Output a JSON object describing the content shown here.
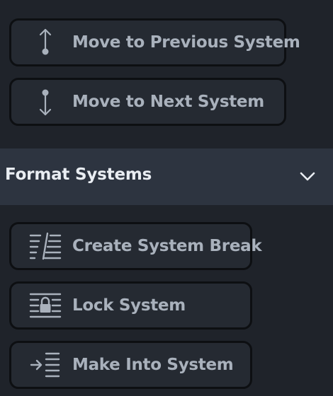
{
  "navigation": {
    "move_previous_label": "Move to Previous System",
    "move_next_label": "Move to Next System"
  },
  "format_systems": {
    "title": "Format Systems",
    "expanded": true,
    "buttons": {
      "create_system_break_label": "Create System Break",
      "lock_system_label": "Lock System",
      "make_into_system_label": "Make Into System"
    }
  },
  "icons": {
    "move_previous": "move-up-arrow-icon",
    "move_next": "move-down-arrow-icon",
    "create_system_break": "system-break-icon",
    "lock_system": "lock-system-icon",
    "make_into_system": "make-into-system-icon",
    "header_toggle": "chevron-down-icon"
  },
  "colors": {
    "background": "#1f232a",
    "header_background": "#2d3440",
    "button_background": "#252a32",
    "button_border": "#0d0f12",
    "label_text": "#a9b1bc",
    "header_text": "#e9edf2"
  }
}
